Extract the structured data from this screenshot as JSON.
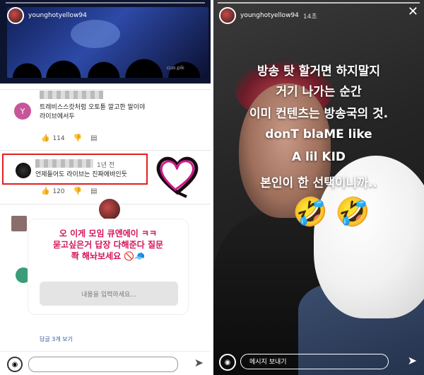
{
  "left": {
    "username": "younghotyellow94",
    "video_tag": "cuo.pik",
    "comments": [
      {
        "avatar_letter": "Y",
        "text_line1": "트레비스스캇처럼 오토튠 깔고한 말이야",
        "text_line2": "라이브에서두",
        "likes": "114"
      },
      {
        "time": "1년 전",
        "text": "언제들어도 라이브는 진짜에바인듯",
        "likes": "120"
      }
    ],
    "question": {
      "line1": "오 이게 모임 큐엔에이 ㅋㅋ",
      "line2": "묻고싶은거 답장 다해준다 질문",
      "line3": "쫙 해놔보세요 🚫🧢",
      "placeholder": "내용을 입력하세요..."
    },
    "more_replies": "답글 3개 보기"
  },
  "right": {
    "username": "younghotyellow94",
    "time": "14초",
    "lines": [
      "방송 탓 할거면 하지말지",
      "거기 나가는 순간",
      "이미 컨텐츠는 방송국의 것.",
      "donT blaME like",
      "A lil KID",
      "본인이 한 선택이니까.."
    ],
    "emoji_1": "🤣",
    "emoji_2": "🤣",
    "message_placeholder": "메시지 보내기"
  },
  "colors": {
    "question_text": "#d4145a",
    "highlight_border": "#e02020"
  }
}
